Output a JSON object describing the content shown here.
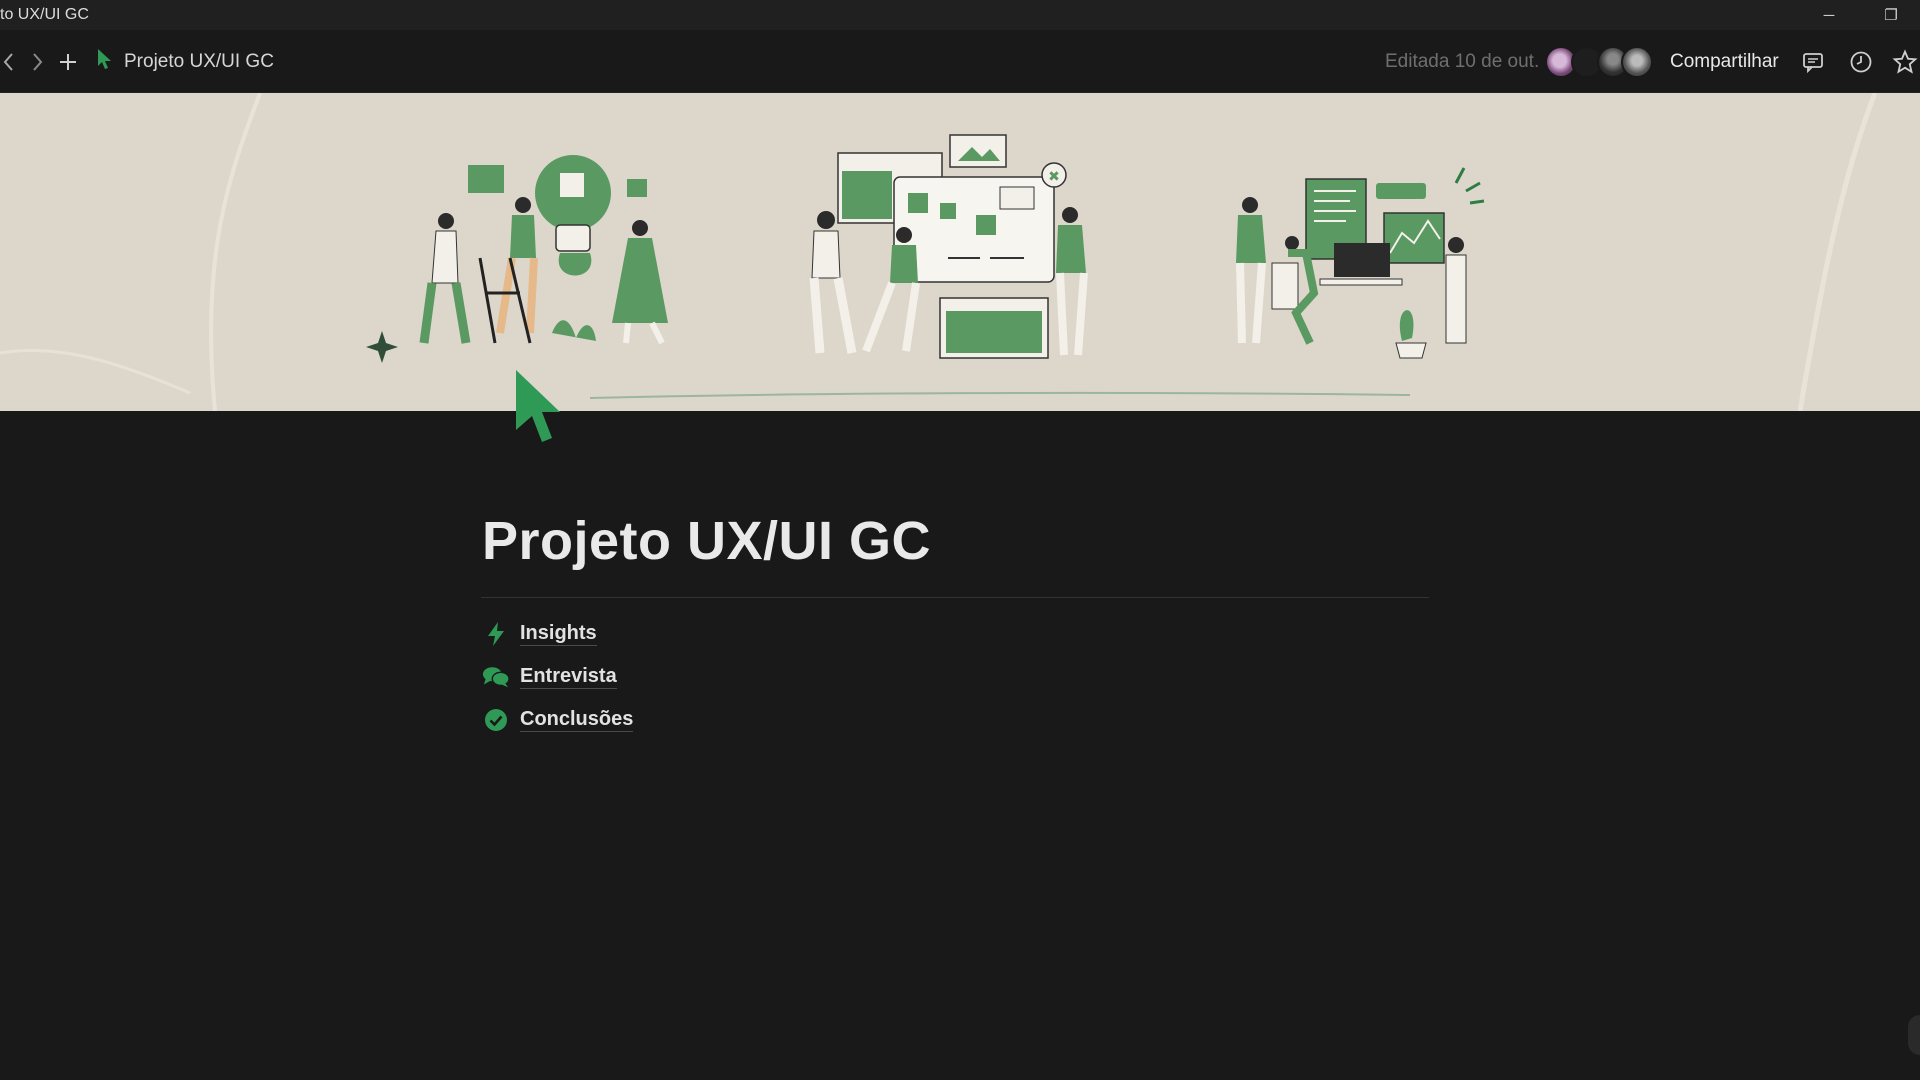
{
  "window": {
    "title": "to UX/UI GC",
    "minimize_glyph": "─",
    "restore_glyph": "❐"
  },
  "toolbar": {
    "breadcrumb_label": "Projeto UX/UI GC",
    "edited_text": "Editada 10 de out.",
    "share_label": "Compartilhar",
    "icons": [
      "back-arrow-icon",
      "forward-arrow-icon",
      "plus-icon",
      "cursor-icon",
      "comment-icon",
      "clock-icon",
      "star-icon"
    ]
  },
  "page": {
    "title": "Projeto UX/UI GC",
    "links": [
      {
        "label": "Insights",
        "icon": "lightning-icon"
      },
      {
        "label": "Entrevista",
        "icon": "chat-bubbles-icon"
      },
      {
        "label": "Conclusões",
        "icon": "check-circle-icon"
      }
    ]
  },
  "colors": {
    "accent_green": "#2e8b4e",
    "cover_bg": "#ddd7cb",
    "illustration_green": "#5a9a62"
  }
}
